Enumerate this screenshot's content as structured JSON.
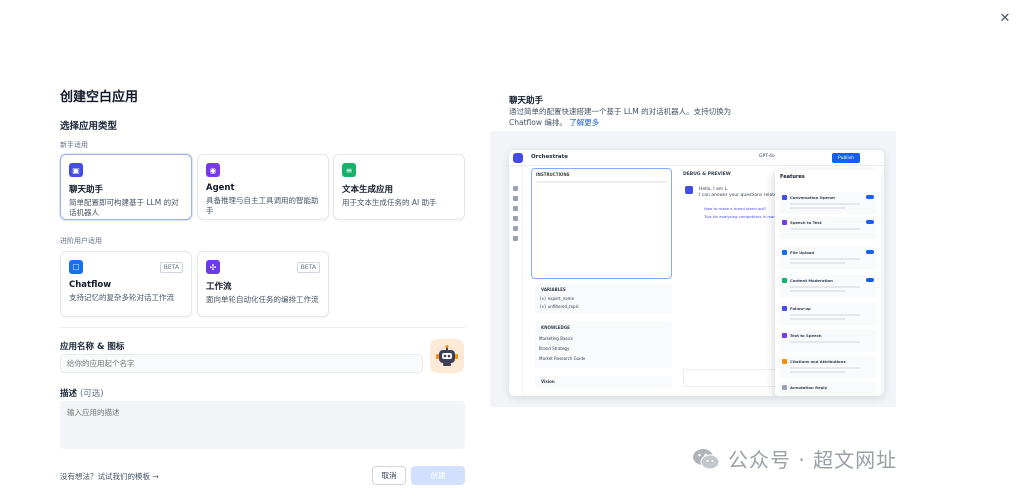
{
  "dialog": {
    "title": "创建空白应用",
    "close_glyph": "✕"
  },
  "app_type": {
    "section_title": "选择应用类型",
    "beginner_label": "新手适用",
    "advanced_label": "进阶用户适用",
    "cards": [
      {
        "title": "聊天助手",
        "desc": "简单配置即可构建基于 LLM 的对话机器人",
        "icon": "chat-bot-icon",
        "color": "#444ce7",
        "selected": true
      },
      {
        "title": "Agent",
        "desc": "具备推理与自主工具调用的智能助手",
        "icon": "agent-icon",
        "color": "#7839ee",
        "selected": false
      },
      {
        "title": "文本生成应用",
        "desc": "用于文本生成任务的 AI 助手",
        "icon": "text-generation-icon",
        "color": "#17b26a",
        "selected": false
      },
      {
        "title": "Chatflow",
        "desc": "支持记忆的复杂多轮对话工作流",
        "icon": "chatflow-icon",
        "color": "#1570ef",
        "badge": "BETA",
        "selected": false
      },
      {
        "title": "工作流",
        "desc": "面向单轮自动化任务的编排工作流",
        "icon": "workflow-icon",
        "color": "#6938ef",
        "badge": "BETA",
        "selected": false
      }
    ]
  },
  "form": {
    "name_label": "应用名称 & 图标",
    "name_placeholder": "给你的应用起个名字",
    "desc_label": "描述",
    "desc_optional": "(可选)",
    "desc_placeholder": "输入应用的描述"
  },
  "footer": {
    "template_link": "没有想法？试试我们的模板 →",
    "cancel_label": "取消",
    "create_label": "创建"
  },
  "preview": {
    "title": "聊天助手",
    "desc": "通过简单的配置快速搭建一个基于 LLM 的对话机器人。支持切换为 Chatflow 编排。",
    "learn_more": "了解更多",
    "app_name": "Orchestrate",
    "model": "GPT-4o",
    "publish": "Publish",
    "instructions_label": "INSTRUCTIONS",
    "debug_label": "DEBUG & PREVIEW",
    "greeting": "Hello, I am L.",
    "greeting2": "I can answer your questions related",
    "suggestion1": "How to make a brand stand out?",
    "suggestion2": "Tips for analyzing competitors in market",
    "variables_label": "VARIABLES",
    "var1": "{x} expert_name",
    "var2": "{x} unfiltered_topic",
    "knowledge_label": "KNOWLEDGE",
    "kb1": "Marketing Basics",
    "kb2": "Brand Strategy",
    "kb3": "Market Research Guide",
    "vision_label": "Vision",
    "features_title": "Features",
    "features": [
      "Conversation Opener",
      "Speech to Text",
      "File Upload",
      "Content Moderation",
      "Follow-up",
      "Text to Speech",
      "Citations and Attributions",
      "Annotation Reply"
    ]
  },
  "watermark": {
    "text": "公众号 · 超文网址"
  }
}
